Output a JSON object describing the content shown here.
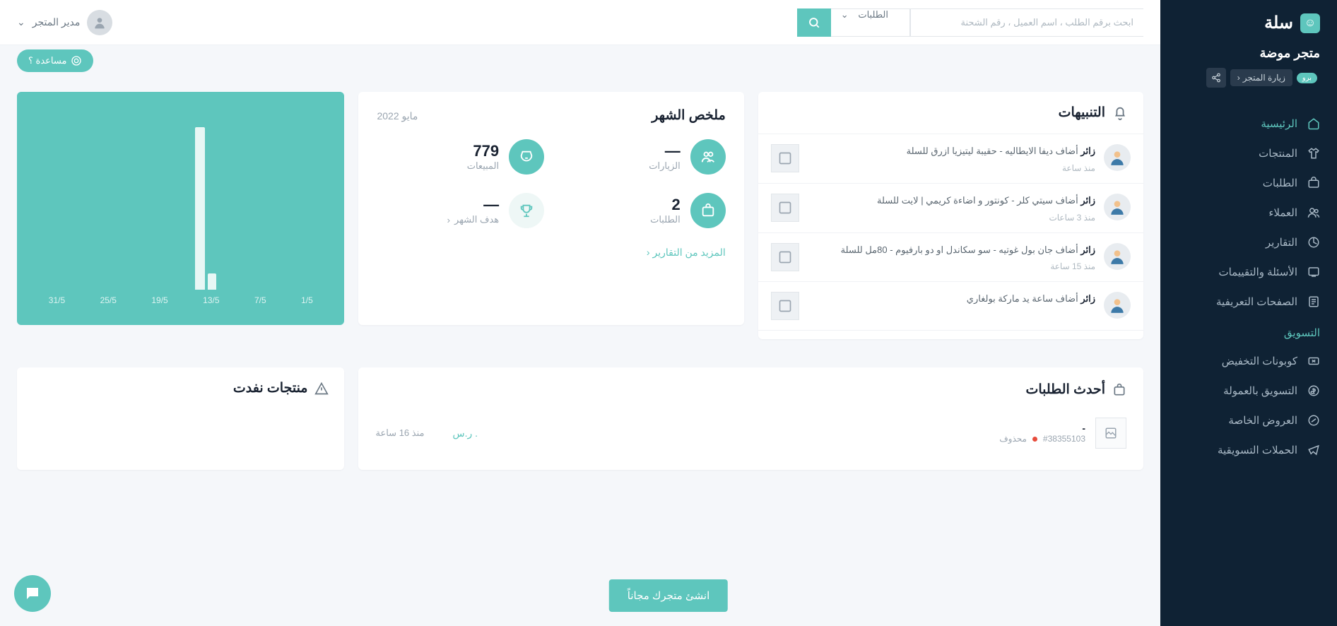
{
  "brand": {
    "name": "سلة"
  },
  "store": {
    "name": "متجر موضة",
    "visit_label": "زيارة المتجر",
    "pro_label": "برو"
  },
  "nav": {
    "items": [
      {
        "label": "الرئيسية",
        "icon": "home"
      },
      {
        "label": "المنتجات",
        "icon": "shirt"
      },
      {
        "label": "الطلبات",
        "icon": "orders"
      },
      {
        "label": "العملاء",
        "icon": "users"
      },
      {
        "label": "التقارير",
        "icon": "reports"
      },
      {
        "label": "الأسئلة والتقييمات",
        "icon": "qa"
      },
      {
        "label": "الصفحات التعريفية",
        "icon": "pages"
      }
    ],
    "marketing_section": "التسويق",
    "marketing": [
      {
        "label": "كوبونات التخفيض"
      },
      {
        "label": "التسويق بالعمولة"
      },
      {
        "label": "العروض الخاصة"
      },
      {
        "label": "الحملات التسويقية"
      }
    ]
  },
  "topbar": {
    "search_placeholder": "ابحث برقم الطلب ، اسم العميل ، رقم الشحنة",
    "filter_label": "الطلبات",
    "user_label": "مدير المتجر"
  },
  "help_label": "مساعدة ؟",
  "summary": {
    "title": "ملخص الشهر",
    "month": "مايو 2022",
    "visits": {
      "label": "الزيارات",
      "value": "—"
    },
    "sales": {
      "label": "المبيعات",
      "value": "779"
    },
    "orders": {
      "label": "الطلبات",
      "value": "2"
    },
    "goal": {
      "label": "هدف الشهر",
      "value": "—"
    },
    "more": "المزيد من التقارير"
  },
  "chart_data": {
    "type": "bar",
    "title": "",
    "categories": [
      "1/5",
      "7/5",
      "13/5",
      "19/5",
      "25/5",
      "31/5"
    ],
    "values": [
      0,
      0,
      100,
      0,
      0,
      0
    ],
    "secondary_bar_index": 2,
    "secondary_bar_height_ratio": 0.1,
    "xlabel": "",
    "ylabel": "",
    "ylim": [
      0,
      100
    ]
  },
  "alerts": {
    "title": "التنبيهات",
    "items": [
      {
        "actor": "زائر",
        "text": "أضاف ديفا الايطاليه - حقيبة ليتيزيا ازرق للسلة",
        "time": "منذ ساعة"
      },
      {
        "actor": "زائر",
        "text": "أضاف سيتي كلر - كونتور و اضاءة كريمي | لايت للسلة",
        "time": "منذ 3 ساعات"
      },
      {
        "actor": "زائر",
        "text": "أضاف جان بول غوتيه - سو سكاندل او دو بارفيوم - 80مل للسلة",
        "time": "منذ 15 ساعة"
      },
      {
        "actor": "زائر",
        "text": "أضاف ساعة يد ماركة بولغاري",
        "time": ""
      }
    ]
  },
  "recent_orders": {
    "title": "أحدث الطلبات",
    "order": {
      "name": "-",
      "id": "#38355103",
      "status": "محذوف",
      "price": ". ر.س",
      "time": "منذ 16 ساعة"
    }
  },
  "oos": {
    "title": "منتجات نفدت"
  },
  "cta_label": "انشئ متجرك مجاناً"
}
